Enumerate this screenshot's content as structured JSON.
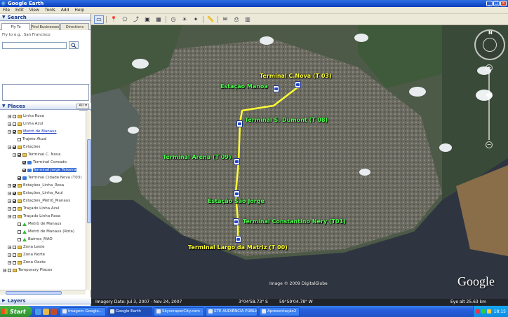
{
  "window": {
    "title": "Google Earth"
  },
  "menu": [
    "File",
    "Edit",
    "View",
    "Tools",
    "Add",
    "Help"
  ],
  "toolbar": {
    "buttons": [
      "hide-sidebar",
      "placemark",
      "polygon",
      "path",
      "overlay",
      "record-tour",
      "historical-imagery",
      "sun",
      "sky",
      "measure",
      "email",
      "print",
      "view-in-maps"
    ]
  },
  "search": {
    "header": "Search",
    "tabs": [
      "Fly To",
      "Find Businesses",
      "Directions"
    ],
    "prompt": "Fly to e.g., San Francisco",
    "value": ""
  },
  "places": {
    "header": "Places",
    "filter_label": "All",
    "items": [
      {
        "label": "Linha Rosa",
        "checked": false,
        "indent": 1,
        "icon": "folder"
      },
      {
        "label": "Linha Azul",
        "checked": false,
        "indent": 1,
        "icon": "folder"
      },
      {
        "label": "Metrô de Manaus",
        "checked": true,
        "indent": 1,
        "icon": "folder",
        "link": true
      },
      {
        "label": "Trajeto Atual",
        "checked": false,
        "indent": 2,
        "icon": "none"
      },
      {
        "label": "Estações",
        "checked": true,
        "indent": 1,
        "icon": "folder"
      },
      {
        "label": "Terminal C. Nova",
        "checked": true,
        "indent": 2,
        "icon": "folder"
      },
      {
        "label": "Terminal Coroado",
        "checked": true,
        "indent": 3,
        "icon": "pin"
      },
      {
        "label": "Terminal Jorge Teixeira",
        "checked": true,
        "indent": 3,
        "icon": "pin",
        "selected": true
      },
      {
        "label": "Terminal Cidade Nova (T03)",
        "checked": true,
        "indent": 2,
        "icon": "pin"
      },
      {
        "label": "Estações_Linha_Rosa",
        "checked": true,
        "indent": 1,
        "icon": "folder"
      },
      {
        "label": "Estações_Linha_Azul",
        "checked": true,
        "indent": 1,
        "icon": "folder"
      },
      {
        "label": "Estações_Metrô_Manaus",
        "checked": true,
        "indent": 1,
        "icon": "folder"
      },
      {
        "label": "Traçado Linha Azul",
        "checked": false,
        "indent": 1,
        "icon": "folder"
      },
      {
        "label": "Traçado Linha Rosa",
        "checked": false,
        "indent": 1,
        "icon": "folder"
      },
      {
        "label": "Metrô de Manaus",
        "checked": false,
        "indent": 2,
        "icon": "tri"
      },
      {
        "label": "Metrô de Manaus (Rota)",
        "checked": false,
        "indent": 2,
        "icon": "tri"
      },
      {
        "label": "Bairros_MAO",
        "checked": false,
        "indent": 2,
        "icon": "tri"
      },
      {
        "label": "Zona Leste",
        "checked": false,
        "indent": 1,
        "icon": "folder"
      },
      {
        "label": "Zona Norte",
        "checked": false,
        "indent": 1,
        "icon": "folder"
      },
      {
        "label": "Zona Oeste",
        "checked": false,
        "indent": 1,
        "icon": "folder"
      },
      {
        "label": "Temporary Places",
        "checked": false,
        "indent": 0,
        "icon": "folder"
      }
    ]
  },
  "layers": {
    "header": "Layers"
  },
  "map": {
    "labels": [
      {
        "text": "Terminal C.Nova (T 03)",
        "color": "yellow"
      },
      {
        "text": "Estação Manoa",
        "color": "green"
      },
      {
        "text": "Terminal S. Dumont (T 08)",
        "color": "green"
      },
      {
        "text": "Terminal Arena (T 09)",
        "color": "green"
      },
      {
        "text": "Estação São Jorge",
        "color": "green"
      },
      {
        "text": "Terminal Constantino Nery (T01)",
        "color": "green"
      },
      {
        "text": "Terminal Largo da Matriz (T 00)",
        "color": "yellow"
      }
    ],
    "copyright": "Image © 2009 DigitalGlobe",
    "logo": "Google",
    "compass_letter": "N",
    "status": {
      "imagery_date": "Imagery Date: Jul 3, 2007 - Nov 24, 2007",
      "lat": "3°04'58.73\" S",
      "lon": "59°59'04.78\" W",
      "eye_alt": "Eye alt  25.63 km"
    },
    "route_color": "#ffff33",
    "label_yellow": "#ffff33",
    "label_green": "#4dff4d"
  },
  "taskbar": {
    "start_label": "Start",
    "tasks": [
      {
        "label": "Imagem Google...",
        "active": false
      },
      {
        "label": "Google Earth",
        "active": true
      },
      {
        "label": "SkyscraperCity.com - ...",
        "active": false
      },
      {
        "label": "STE AUDIÊNCIA PÚBLIC...",
        "active": false
      },
      {
        "label": "Apresentação2",
        "active": false
      }
    ],
    "clock": "18:15"
  }
}
